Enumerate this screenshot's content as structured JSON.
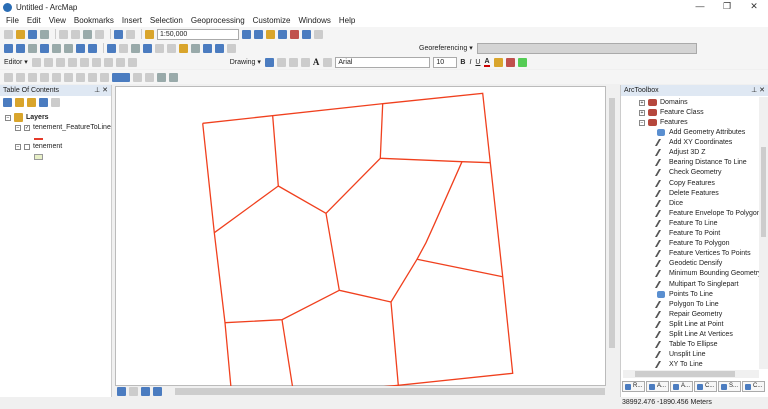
{
  "window": {
    "title": "Untitled - ArcMap",
    "minimize": "—",
    "restore": "❐",
    "close": "✕"
  },
  "menu": [
    "File",
    "Edit",
    "View",
    "Bookmarks",
    "Insert",
    "Selection",
    "Geoprocessing",
    "Customize",
    "Windows",
    "Help"
  ],
  "toolbar": {
    "scale": "1:50,000",
    "editor": "Editor ▾",
    "drawing": "Drawing ▾",
    "georeferencing": "Georeferencing ▾",
    "font": "Arial",
    "font_size": "10",
    "bold": "B",
    "italic": "I",
    "underline": "U",
    "font_color": "A"
  },
  "toc": {
    "title": "Table Of Contents",
    "layers_label": "Layers",
    "layers": [
      {
        "name": "tenement_FeatureToLine",
        "checked": true,
        "symbol_color": "#e53a2a"
      },
      {
        "name": "tenement",
        "checked": false,
        "symbol_color": "#e8f0c8"
      }
    ]
  },
  "map": {
    "line_color": "#f0401e"
  },
  "arctoolbox": {
    "title": "ArcToolbox",
    "toolsets": [
      "Domains",
      "Feature Class",
      "Features"
    ],
    "tools": [
      {
        "name": "Add Geometry Attributes",
        "type": "script"
      },
      {
        "name": "Add XY Coordinates",
        "type": "tool"
      },
      {
        "name": "Adjust 3D Z",
        "type": "tool"
      },
      {
        "name": "Bearing Distance To Line",
        "type": "tool"
      },
      {
        "name": "Check Geometry",
        "type": "tool"
      },
      {
        "name": "Copy Features",
        "type": "tool"
      },
      {
        "name": "Delete Features",
        "type": "tool"
      },
      {
        "name": "Dice",
        "type": "tool"
      },
      {
        "name": "Feature Envelope To Polygon",
        "type": "tool"
      },
      {
        "name": "Feature To Line",
        "type": "tool"
      },
      {
        "name": "Feature To Point",
        "type": "tool"
      },
      {
        "name": "Feature To Polygon",
        "type": "tool"
      },
      {
        "name": "Feature Vertices To Points",
        "type": "tool"
      },
      {
        "name": "Geodetic Densify",
        "type": "tool"
      },
      {
        "name": "Minimum Bounding Geometry",
        "type": "tool"
      },
      {
        "name": "Multipart To Singlepart",
        "type": "tool"
      },
      {
        "name": "Points To Line",
        "type": "script"
      },
      {
        "name": "Polygon To Line",
        "type": "tool"
      },
      {
        "name": "Repair Geometry",
        "type": "tool"
      },
      {
        "name": "Split Line at Point",
        "type": "tool"
      },
      {
        "name": "Split Line At Vertices",
        "type": "tool"
      },
      {
        "name": "Table To Ellipse",
        "type": "tool"
      },
      {
        "name": "Unsplit Line",
        "type": "tool"
      },
      {
        "name": "XY To Line",
        "type": "tool"
      }
    ],
    "bottom_tabs": [
      "R...",
      "A...",
      "A...",
      "C...",
      "S...",
      "C..."
    ]
  },
  "status": {
    "coordinates": "38992.476  -1890.456 Meters"
  }
}
